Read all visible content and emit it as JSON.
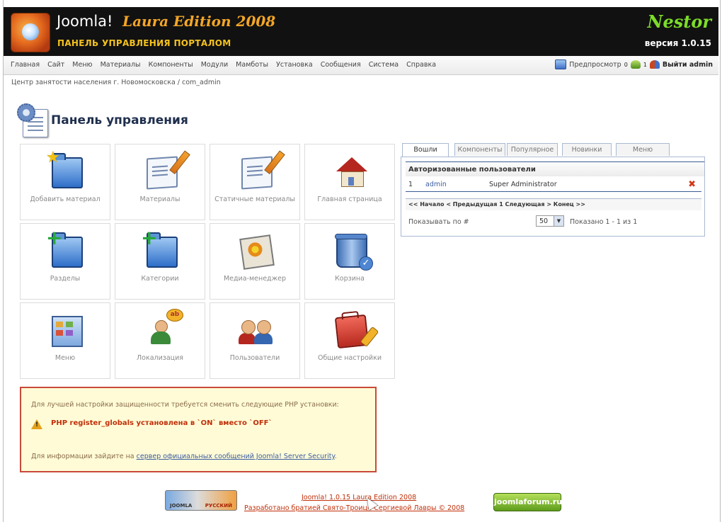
{
  "header": {
    "brand": "Joomla!",
    "edition": "Laura Edition 2008",
    "subtitle": "ПАНЕЛЬ УПРАВЛЕНИЯ ПОРТАЛОМ",
    "nestor": "Nestor",
    "version": "версия 1.0.15"
  },
  "menu": {
    "items": [
      "Главная",
      "Сайт",
      "Меню",
      "Материалы",
      "Компоненты",
      "Модули",
      "Мамботы",
      "Установка",
      "Сообщения",
      "Система",
      "Справка"
    ],
    "preview": "Предпросмотр",
    "messages_count": "0",
    "users_count": "1",
    "logout": "Выйти admin"
  },
  "breadcrumb": "Центр занятости населения г. Новомосковска / com_admin",
  "page_title": "Панель управления",
  "grid": [
    {
      "label": "Добавить материал",
      "icon": "add-content-icon"
    },
    {
      "label": "Материалы",
      "icon": "content-icon"
    },
    {
      "label": "Статичные материалы",
      "icon": "static-content-icon"
    },
    {
      "label": "Главная страница",
      "icon": "home-icon"
    },
    {
      "label": "Разделы",
      "icon": "sections-icon"
    },
    {
      "label": "Категории",
      "icon": "categories-icon"
    },
    {
      "label": "Медиа-менеджер",
      "icon": "media-icon"
    },
    {
      "label": "Корзина",
      "icon": "trash-icon"
    },
    {
      "label": "Меню",
      "icon": "menu-icon"
    },
    {
      "label": "Локализация",
      "icon": "language-icon"
    },
    {
      "label": "Пользователи",
      "icon": "users-icon"
    },
    {
      "label": "Общие настройки",
      "icon": "config-icon"
    }
  ],
  "warning": {
    "line1": "Для лучшей настройки защищенности требуется сменить следующие PHP установки:",
    "line2": "PHP register_globals установлена в `ON` вместо `OFF`",
    "line3_prefix": "Для информации зайдите на ",
    "line3_link": "сервер официальных сообщений Joomla! Server Security",
    "line3_suffix": "."
  },
  "tabs": [
    "Вошли",
    "Компоненты",
    "Популярное",
    "Новинки",
    "Меню"
  ],
  "logged": {
    "header": "Авторизованные пользователи",
    "rows": [
      {
        "num": "1",
        "user": "admin",
        "role": "Super Administrator"
      }
    ],
    "pager": "<< Начало < Предыдущая 1 Следующая > Конец >>",
    "show_label": "Показывать по #",
    "per_page": "50",
    "shown": "Показано 1 - 1 из 1"
  },
  "footer": {
    "line1": "Joomla! 1.0.15 Laura Edition 2008",
    "line2": "Разработано братией Свято-Троице-Сергиевой Лавры © 2008",
    "badge": "joomlaforum.ru"
  }
}
